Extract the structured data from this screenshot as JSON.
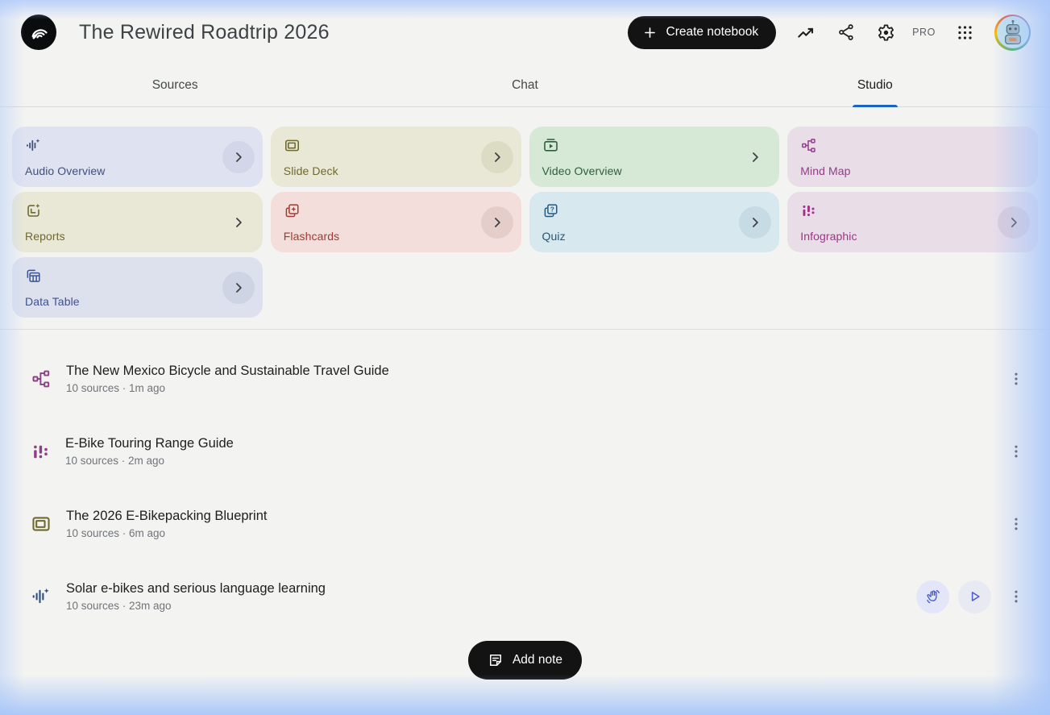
{
  "header": {
    "title": "The Rewired Roadtrip 2026",
    "create_button_label": "Create notebook",
    "pro_label": "PRO"
  },
  "tabs": [
    {
      "label": "Sources",
      "active": false
    },
    {
      "label": "Chat",
      "active": false
    },
    {
      "label": "Studio",
      "active": true
    }
  ],
  "colors": {
    "accent_underline": "#1a63c1",
    "button_black": "#131314",
    "edge_glow_blue": "#a8c7fa",
    "audio_action_indigo": "#4a5ad2"
  },
  "studio": {
    "cards": [
      {
        "label": "Audio Overview",
        "icon": "audio-waveform-sparkle-icon",
        "bg": "#dfe2f0",
        "fg": "#414f79",
        "chevron_bg": "#d2d6e8"
      },
      {
        "label": "Slide Deck",
        "icon": "slide-deck-icon",
        "bg": "#e9e8d6",
        "fg": "#6f692d",
        "chevron_bg": "#dcdbc3"
      },
      {
        "label": "Video Overview",
        "icon": "video-overview-icon",
        "bg": "#d6e9d7",
        "fg": "#305d3b",
        "chevron_bg": "transparent"
      },
      {
        "label": "Mind Map",
        "icon": "mind-map-icon",
        "bg": "#e9dde8",
        "fg": "#8f3f87",
        "chevron_bg": "transparent"
      },
      {
        "label": "Reports",
        "icon": "reports-icon",
        "bg": "#e9e8d6",
        "fg": "#6f692d",
        "chevron_bg": "transparent"
      },
      {
        "label": "Flashcards",
        "icon": "flashcards-icon",
        "bg": "#f3dedb",
        "fg": "#a03b30",
        "chevron_bg": "#e5ceca"
      },
      {
        "label": "Quiz",
        "icon": "quiz-icon",
        "bg": "#d7e8ee",
        "fg": "#27567b",
        "chevron_bg": "#c7dbe4"
      },
      {
        "label": "Infographic",
        "icon": "infographic-icon",
        "bg": "#e9dde8",
        "fg": "#a03387",
        "chevron_bg": "#dbccd9"
      },
      {
        "label": "Data Table",
        "icon": "data-table-icon",
        "bg": "#dde1ee",
        "fg": "#3d5294",
        "chevron_bg": "#cfd4e5"
      }
    ]
  },
  "artifacts": [
    {
      "icon": "mind-map-icon",
      "icon_color": "#8f3f87",
      "title": "The New Mexico Bicycle and Sustainable Travel Guide",
      "meta": "10 sources · 1m ago"
    },
    {
      "icon": "infographic-icon",
      "icon_color": "#8f3f87",
      "title": "E-Bike Touring Range Guide",
      "meta": "10 sources · 2m ago"
    },
    {
      "icon": "slide-deck-icon",
      "icon_color": "#6f692d",
      "title": "The 2026 E-Bikepacking Blueprint",
      "meta": "10 sources · 6m ago"
    },
    {
      "icon": "audio-waveform-sparkle-icon",
      "icon_color": "#33517e",
      "title": "Solar e-bikes and serious language learning",
      "meta": "10 sources · 23m ago"
    }
  ],
  "footer": {
    "add_note_label": "Add note"
  }
}
